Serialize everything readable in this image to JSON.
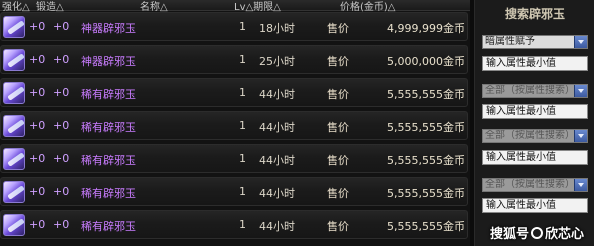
{
  "header": {
    "enhance": "强化△",
    "amplify": "锻造△",
    "name": "名称△",
    "lv_time": "Lv△期限△",
    "price": "价格(金币)△"
  },
  "rows": [
    {
      "enhance": "+0",
      "amplify": "+0",
      "name": "神器辟邪玉",
      "count": "1",
      "time": "18小时",
      "sell_label": "售价",
      "price": "4,999,999金币"
    },
    {
      "enhance": "+0",
      "amplify": "+0",
      "name": "神器辟邪玉",
      "count": "1",
      "time": "25小时",
      "sell_label": "售价",
      "price": "5,000,000金币"
    },
    {
      "enhance": "+0",
      "amplify": "+0",
      "name": "稀有辟邪玉",
      "count": "1",
      "time": "44小时",
      "sell_label": "售价",
      "price": "5,555,555金币"
    },
    {
      "enhance": "+0",
      "amplify": "+0",
      "name": "稀有辟邪玉",
      "count": "1",
      "time": "44小时",
      "sell_label": "售价",
      "price": "5,555,555金币"
    },
    {
      "enhance": "+0",
      "amplify": "+0",
      "name": "稀有辟邪玉",
      "count": "1",
      "time": "44小时",
      "sell_label": "售价",
      "price": "5,555,555金币"
    },
    {
      "enhance": "+0",
      "amplify": "+0",
      "name": "稀有辟邪玉",
      "count": "1",
      "time": "44小时",
      "sell_label": "售价",
      "price": "5,555,555金币"
    },
    {
      "enhance": "+0",
      "amplify": "+0",
      "name": "稀有辟邪玉",
      "count": "1",
      "time": "44小时",
      "sell_label": "售价",
      "price": "5,555,555金币"
    }
  ],
  "panel": {
    "title": "搜索辟邪玉",
    "filters": [
      {
        "select": "暗属性赋予",
        "input_placeholder": "输入属性最小值",
        "active": true
      },
      {
        "select": "全部（按属性搜索）",
        "input_placeholder": "输入属性最小值",
        "active": false
      },
      {
        "select": "全部（按属性搜索）",
        "input_placeholder": "输入属性最小值",
        "active": false
      },
      {
        "select": "全部（按属性搜索）",
        "input_placeholder": "输入属性最小值",
        "active": false
      }
    ]
  },
  "watermark": {
    "prefix": "搜狐号",
    "suffix": "欣芯心"
  }
}
